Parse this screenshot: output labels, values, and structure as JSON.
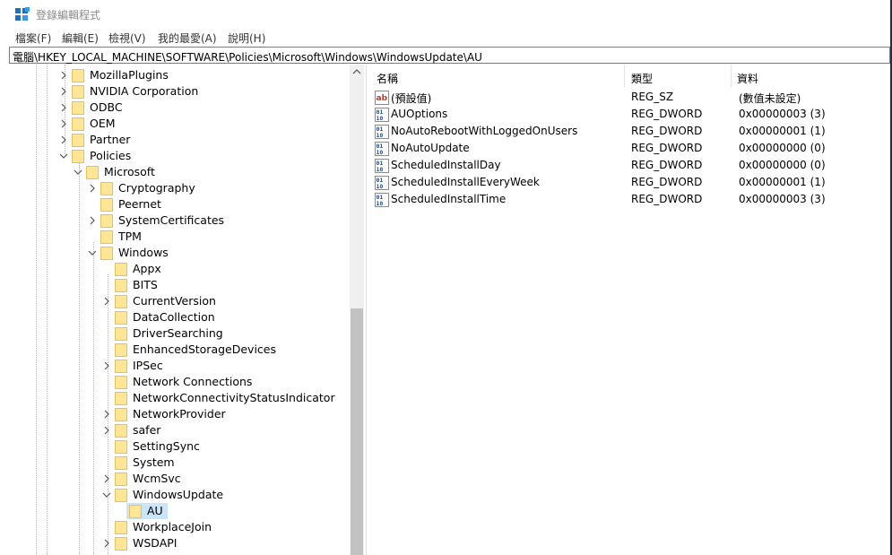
{
  "window": {
    "title": "登錄編輯程式"
  },
  "menu": [
    "檔案(F)",
    "編輯(E)",
    "檢視(V)",
    "我的最愛(A)",
    "說明(H)"
  ],
  "address": "電腦\\HKEY_LOCAL_MACHINE\\SOFTWARE\\Policies\\Microsoft\\Windows\\WindowsUpdate\\AU",
  "tree": [
    {
      "label": "MozillaPlugins",
      "level": 0,
      "state": "collapsed"
    },
    {
      "label": "NVIDIA Corporation",
      "level": 0,
      "state": "collapsed"
    },
    {
      "label": "ODBC",
      "level": 0,
      "state": "collapsed"
    },
    {
      "label": "OEM",
      "level": 0,
      "state": "collapsed"
    },
    {
      "label": "Partner",
      "level": 0,
      "state": "collapsed"
    },
    {
      "label": "Policies",
      "level": 0,
      "state": "expanded"
    },
    {
      "label": "Microsoft",
      "level": 1,
      "state": "expanded"
    },
    {
      "label": "Cryptography",
      "level": 2,
      "state": "collapsed"
    },
    {
      "label": "Peernet",
      "level": 2,
      "state": "none"
    },
    {
      "label": "SystemCertificates",
      "level": 2,
      "state": "collapsed"
    },
    {
      "label": "TPM",
      "level": 2,
      "state": "none"
    },
    {
      "label": "Windows",
      "level": 2,
      "state": "expanded"
    },
    {
      "label": "Appx",
      "level": 3,
      "state": "none"
    },
    {
      "label": "BITS",
      "level": 3,
      "state": "none"
    },
    {
      "label": "CurrentVersion",
      "level": 3,
      "state": "collapsed"
    },
    {
      "label": "DataCollection",
      "level": 3,
      "state": "none"
    },
    {
      "label": "DriverSearching",
      "level": 3,
      "state": "none"
    },
    {
      "label": "EnhancedStorageDevices",
      "level": 3,
      "state": "none"
    },
    {
      "label": "IPSec",
      "level": 3,
      "state": "collapsed"
    },
    {
      "label": "Network Connections",
      "level": 3,
      "state": "none"
    },
    {
      "label": "NetworkConnectivityStatusIndicator",
      "level": 3,
      "state": "none"
    },
    {
      "label": "NetworkProvider",
      "level": 3,
      "state": "collapsed"
    },
    {
      "label": "safer",
      "level": 3,
      "state": "collapsed"
    },
    {
      "label": "SettingSync",
      "level": 3,
      "state": "none"
    },
    {
      "label": "System",
      "level": 3,
      "state": "none"
    },
    {
      "label": "WcmSvc",
      "level": 3,
      "state": "collapsed"
    },
    {
      "label": "WindowsUpdate",
      "level": 3,
      "state": "expanded"
    },
    {
      "label": "AU",
      "level": 4,
      "state": "none",
      "selected": true
    },
    {
      "label": "WorkplaceJoin",
      "level": 3,
      "state": "none"
    },
    {
      "label": "WSDAPI",
      "level": 3,
      "state": "collapsed"
    }
  ],
  "columns": {
    "name": "名稱",
    "type": "類型",
    "data": "資料"
  },
  "values": [
    {
      "name": "(預設值)",
      "type": "REG_SZ",
      "data": "(數值未設定)",
      "icon": "string-value-icon"
    },
    {
      "name": "AUOptions",
      "type": "REG_DWORD",
      "data": "0x00000003 (3)",
      "icon": "dword-value-icon"
    },
    {
      "name": "NoAutoRebootWithLoggedOnUsers",
      "type": "REG_DWORD",
      "data": "0x00000001 (1)",
      "icon": "dword-value-icon"
    },
    {
      "name": "NoAutoUpdate",
      "type": "REG_DWORD",
      "data": "0x00000000 (0)",
      "icon": "dword-value-icon"
    },
    {
      "name": "ScheduledInstallDay",
      "type": "REG_DWORD",
      "data": "0x00000000 (0)",
      "icon": "dword-value-icon"
    },
    {
      "name": "ScheduledInstallEveryWeek",
      "type": "REG_DWORD",
      "data": "0x00000001 (1)",
      "icon": "dword-value-icon"
    },
    {
      "name": "ScheduledInstallTime",
      "type": "REG_DWORD",
      "data": "0x00000003 (3)",
      "icon": "dword-value-icon"
    }
  ],
  "colors": {
    "selection": "#cce4f7",
    "folder": "#ffe596",
    "dword_icon": "#1f4e9a",
    "string_icon": "#c0392b"
  }
}
